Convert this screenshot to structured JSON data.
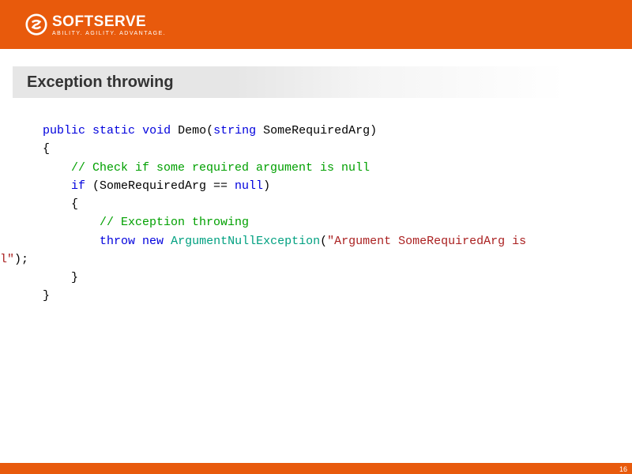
{
  "header": {
    "logo_main": "SOFTSERVE",
    "logo_sub": "Ability. Agility. Advantage."
  },
  "slide": {
    "title": "Exception throwing",
    "page_number": "16"
  },
  "code": {
    "kw_public": "public",
    "kw_static": "static",
    "kw_void": "void",
    "method": "Demo",
    "p_open": "(",
    "type_string": "string",
    "param": " SomeRequiredArg)",
    "brace_open": "{",
    "comment1": "// Check if some required argument is null",
    "kw_if": "if",
    "cond": " (SomeRequiredArg == ",
    "kw_null": "null",
    "cond_end": ")",
    "comment2": "// Exception throwing",
    "kw_throw": "throw",
    "kw_new": "new",
    "cls_ex": "ArgumentNullException",
    "ex_open": "(",
    "str_msg": "\"Argument SomeRequiredArg is",
    "line_frag": "l\"",
    "stmt_end": ");",
    "brace_close": "}"
  }
}
